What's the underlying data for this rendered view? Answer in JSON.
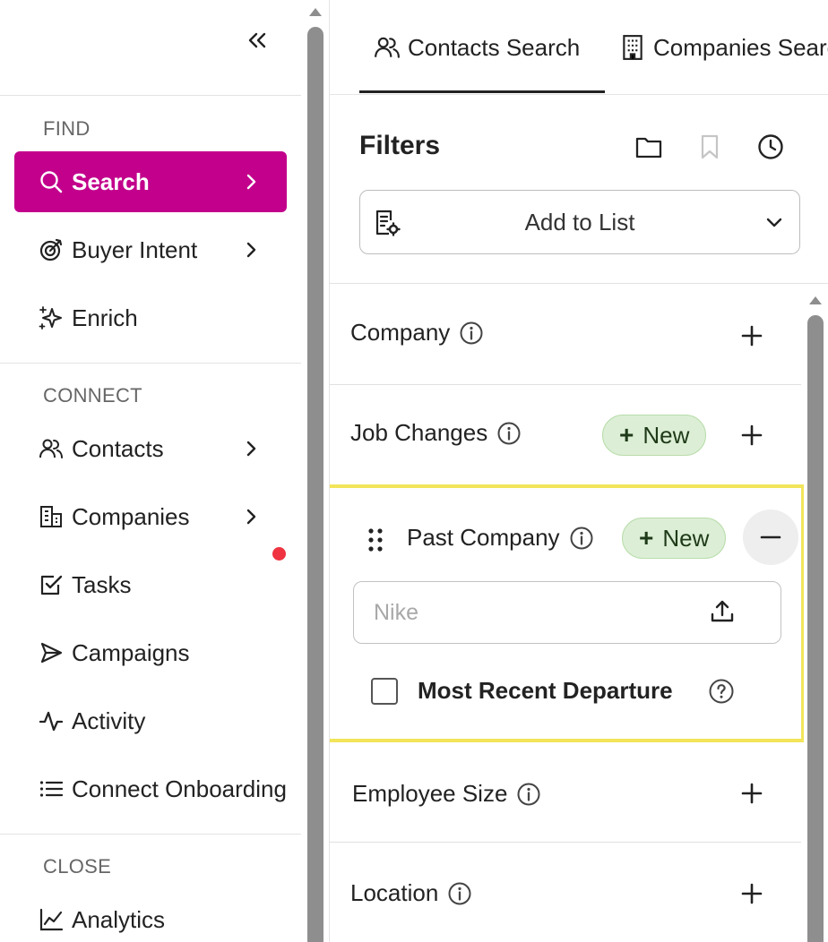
{
  "sidebar": {
    "collapse_icon": "double-chevron-left-icon",
    "sections": {
      "find": "FIND",
      "connect": "CONNECT",
      "close": "CLOSE"
    },
    "items": {
      "search": "Search",
      "buyer_intent": "Buyer Intent",
      "enrich": "Enrich",
      "contacts": "Contacts",
      "companies": "Companies",
      "tasks": "Tasks",
      "campaigns": "Campaigns",
      "activity": "Activity",
      "connect_onboarding": "Connect Onboarding",
      "analytics": "Analytics"
    },
    "active_color": "#c2008c",
    "notification_dot_color": "#ef3340"
  },
  "tabs": {
    "contacts_search": "Contacts Search",
    "companies_search": "Companies Search"
  },
  "filters": {
    "title": "Filters",
    "header_icons": [
      "folder-icon",
      "bookmark-icon",
      "history-clock-icon"
    ],
    "add_to_list": "Add to List",
    "rows": {
      "company": "Company",
      "job_changes": "Job Changes",
      "past_company": "Past Company",
      "employee_size": "Employee Size",
      "location": "Location"
    },
    "new_badge": "New",
    "past_company_input": {
      "value": "",
      "placeholder": "Nike"
    },
    "most_recent_departure": "Most Recent Departure",
    "new_badge_color": "#dcefd6",
    "highlight_color": "#f2e55a"
  }
}
